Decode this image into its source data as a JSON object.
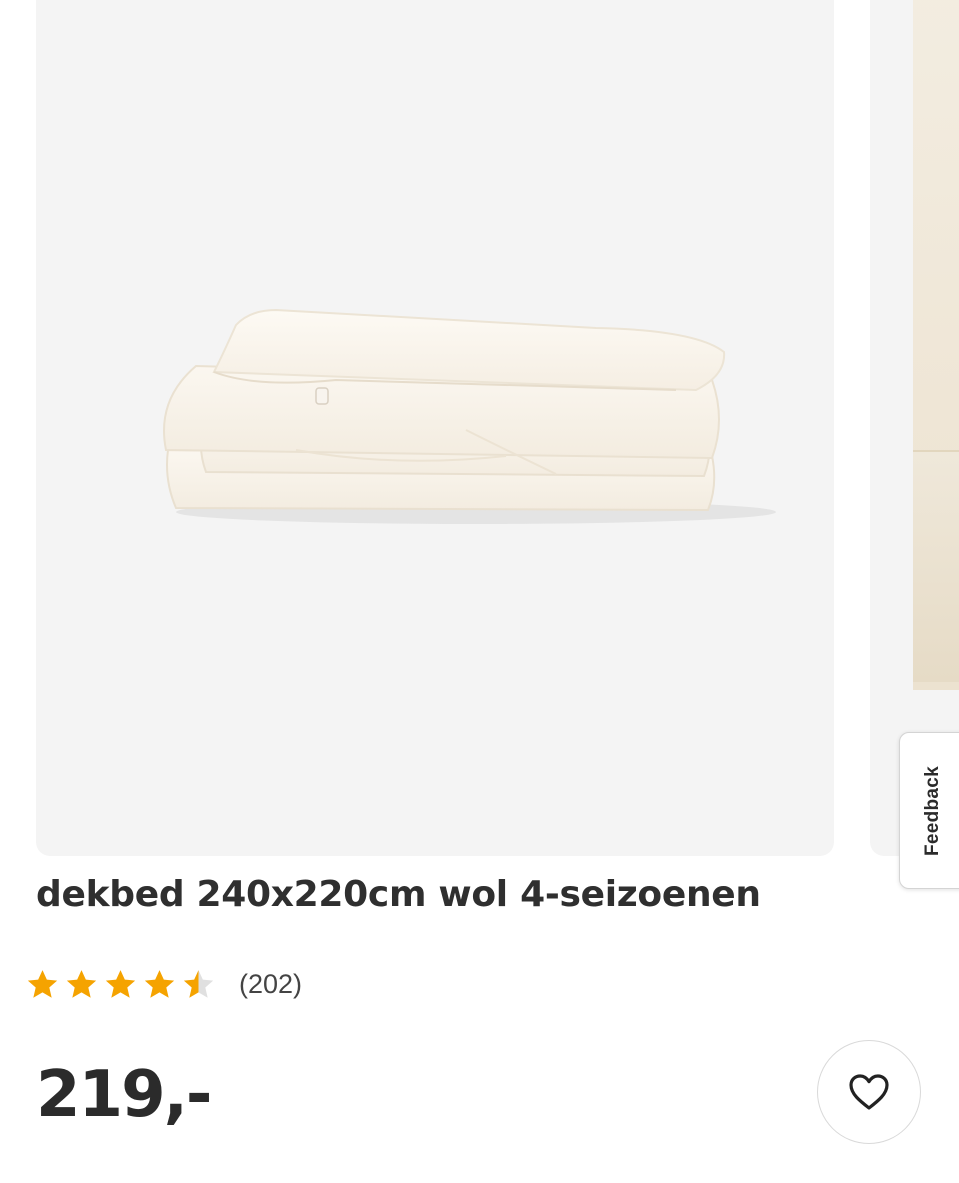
{
  "product": {
    "title": "dekbed 240x220cm wol 4-seizoenen",
    "rating": {
      "value": 4.5,
      "max": 5,
      "review_count_text": "(202)"
    },
    "price": "219,-"
  },
  "feedback": {
    "label": "Feedback"
  },
  "icons": {
    "star": "star-icon",
    "wishlist": "heart-icon"
  },
  "colors": {
    "star": "#f5a300",
    "star_empty": "#e0e0e0",
    "text": "#2b2b2b",
    "image_bg": "#f4f4f4"
  }
}
